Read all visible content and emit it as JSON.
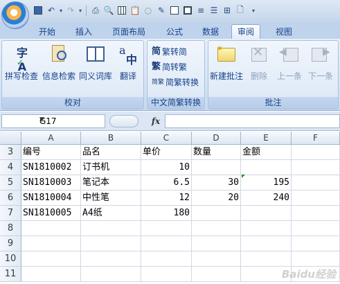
{
  "ribbon": {
    "tabs": [
      "开始",
      "插入",
      "页面布局",
      "公式",
      "数据",
      "审阅",
      "视图"
    ],
    "active_tab": "审阅",
    "groups": {
      "proofing": {
        "title": "校对",
        "buttons": [
          "拼写检查",
          "信息检索",
          "同义词库",
          "翻译"
        ]
      },
      "chinese_conversion": {
        "title": "中文简繁转换",
        "buttons": [
          "繁转简",
          "简转繁",
          "简繁转换"
        ]
      },
      "comments": {
        "title": "批注",
        "buttons": [
          "新建批注",
          "删除",
          "上一条",
          "下一条"
        ]
      }
    }
  },
  "formula_bar": {
    "name_box": "G17",
    "fx_label": "fx",
    "formula": ""
  },
  "sheet": {
    "columns": [
      "A",
      "B",
      "C",
      "D",
      "E",
      "F"
    ],
    "rows": [
      {
        "num": "3",
        "cells": [
          "编号",
          "品名",
          "单价",
          "数量",
          "金额",
          ""
        ]
      },
      {
        "num": "4",
        "cells": [
          "SN1810002",
          "订书机",
          "10",
          "",
          "",
          ""
        ]
      },
      {
        "num": "5",
        "cells": [
          "SN1810003",
          "笔记本",
          "6.5",
          "30",
          "195",
          ""
        ]
      },
      {
        "num": "6",
        "cells": [
          "SN1810004",
          "中性笔",
          "12",
          "20",
          "240",
          ""
        ]
      },
      {
        "num": "7",
        "cells": [
          "SN1810005",
          "A4纸",
          "180",
          "",
          "",
          ""
        ]
      },
      {
        "num": "8",
        "cells": [
          "",
          "",
          "",
          "",
          "",
          ""
        ]
      },
      {
        "num": "9",
        "cells": [
          "",
          "",
          "",
          "",
          "",
          ""
        ]
      },
      {
        "num": "10",
        "cells": [
          "",
          "",
          "",
          "",
          "",
          ""
        ]
      },
      {
        "num": "11",
        "cells": [
          "",
          "",
          "",
          "",
          "",
          ""
        ]
      }
    ]
  },
  "watermark": "Baidu经验"
}
